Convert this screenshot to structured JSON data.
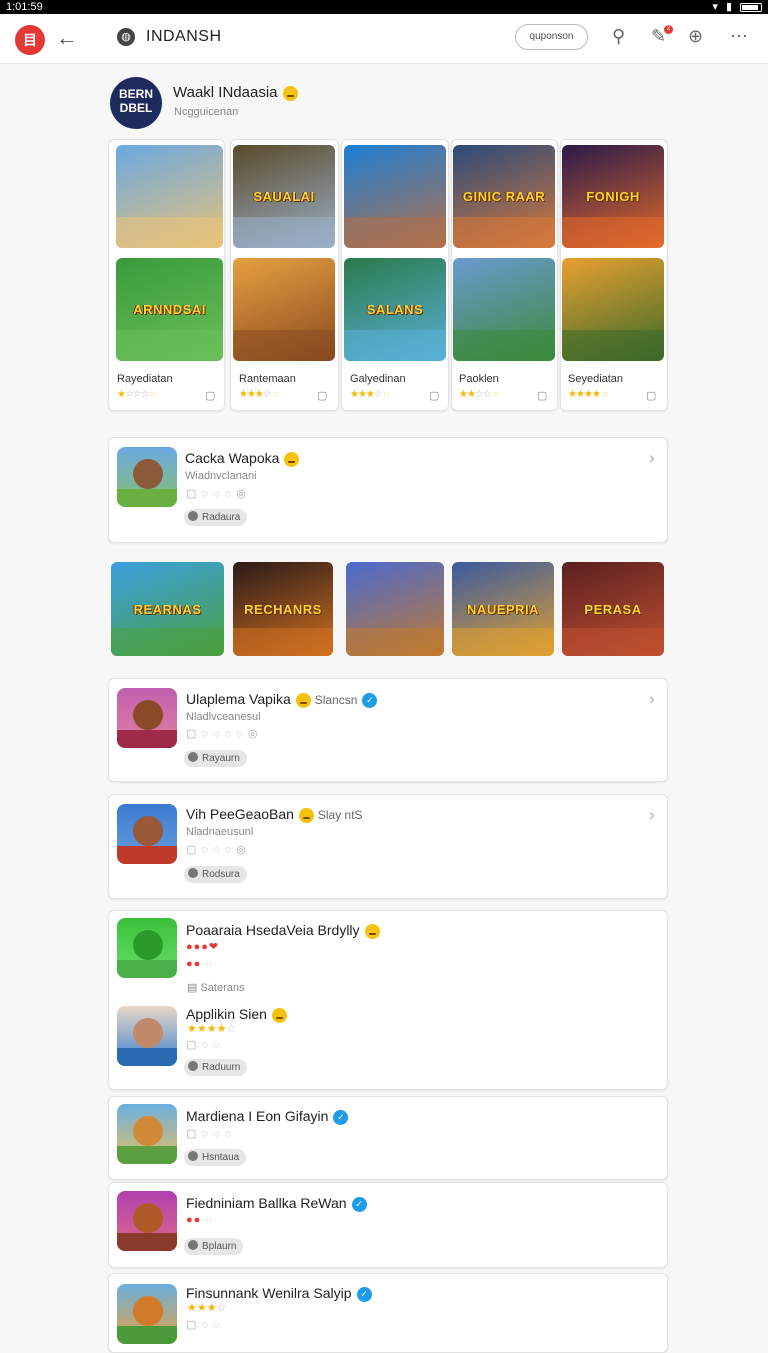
{
  "statusbar": {
    "time": "1:01:59"
  },
  "topbar": {
    "app_icon_label": "目",
    "title": "INDANSH",
    "pill_label": "quponson",
    "notification_count": "2"
  },
  "profile": {
    "avatar_text": "BERN DBEL",
    "name": "Waakl INdaasia",
    "subtitle": "Ncgguicenan"
  },
  "featured": {
    "tiles_row1": [
      {
        "text": "",
        "colors": [
          "#6aa8e0",
          "#e9c27a"
        ]
      },
      {
        "text": "SAUALAI",
        "colors": [
          "#5a4a2a",
          "#9bb0c8"
        ]
      },
      {
        "text": "",
        "colors": [
          "#1e7fd6",
          "#b0704a"
        ]
      },
      {
        "text": "GINIC RAAR",
        "colors": [
          "#2a4a7a",
          "#d7793a"
        ]
      },
      {
        "text": "FONIGH",
        "colors": [
          "#2a1a4a",
          "#e36a2a"
        ]
      }
    ],
    "tiles_row2": [
      {
        "text": "ARNNDSAI",
        "colors": [
          "#3a9a3a",
          "#6ac05a"
        ]
      },
      {
        "text": "",
        "colors": [
          "#e6a040",
          "#8a4a20"
        ]
      },
      {
        "text": "SALANS",
        "colors": [
          "#2a7a4a",
          "#5ab0d8"
        ]
      },
      {
        "text": "",
        "colors": [
          "#6a9ad0",
          "#3a8a3a"
        ]
      },
      {
        "text": "",
        "colors": [
          "#e8a030",
          "#3a6a2a"
        ]
      }
    ],
    "labels": [
      "Rayediatan",
      "Rantemaan",
      "Galyedinan",
      "Paoklen",
      "Seyediatan"
    ],
    "ratings": [
      1,
      3,
      3,
      2,
      4
    ]
  },
  "list1": {
    "title": "Cacka Wapoka",
    "subtitle": "Wiadnvclanani",
    "tag": "Radaura"
  },
  "banners": [
    {
      "text": "REARNAS",
      "colors": [
        "#3aa0e0",
        "#4aa040"
      ]
    },
    {
      "text": "RECHANRS",
      "colors": [
        "#2a1a1a",
        "#d07020"
      ]
    },
    {
      "text": "",
      "colors": [
        "#4a6ad0",
        "#c07a30"
      ]
    },
    {
      "text": "NAUEPRIA",
      "colors": [
        "#3a5aa0",
        "#e0a030"
      ]
    },
    {
      "text": "PERASA",
      "colors": [
        "#5a2020",
        "#c05030"
      ]
    }
  ],
  "list2": {
    "title": "Ulaplema  Vapika",
    "extra": "Slancsn",
    "subtitle": "Nladlvceanesul",
    "tag": "Rayaurn"
  },
  "list3": {
    "title": "Vih PeeGeaoBan",
    "extra": "Slay ntS",
    "subtitle": "Nladnaeusunl",
    "tag": "Rodsura"
  },
  "list4": {
    "title": "Poaaraia HsedaVeia Brdylly",
    "note": "Saterans",
    "title2": "Applikin Sien",
    "tag": "Raduurn"
  },
  "list5": {
    "title": "Mardiena I Eon Gifayin",
    "tag": "Hsntaua"
  },
  "list6": {
    "title": "Fiedniniam Ballka ReWan",
    "tag": "Bplaurn"
  },
  "list7": {
    "title": "Finsunnank Wenilra Salyip"
  }
}
